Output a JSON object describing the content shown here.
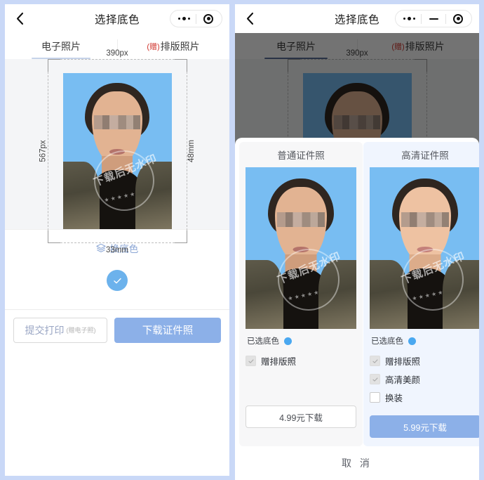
{
  "app": {
    "nav": {
      "title": "选择底色",
      "back_icon": "chevron-left-icon",
      "menu_icon": "more-dots-icon",
      "minimize_icon": "minimize-dash-icon",
      "target_icon": "target-circle-icon"
    },
    "tabs": [
      {
        "label": "电子照片",
        "gift": "",
        "active": true
      },
      {
        "label": "排版照片",
        "gift": "(赠)",
        "active": false
      }
    ]
  },
  "preview": {
    "width_px_label": "390px",
    "height_px_label": "567px",
    "width_mm_label": "33mm",
    "height_mm_label": "48mm",
    "watermark": "下载后无水印",
    "watermark_stars": "★ ★ ★ ★ ★",
    "background_color": "#78bdf2"
  },
  "change_color": {
    "label": "换底色",
    "icon": "layers-icon",
    "swatch_icon": "check-icon",
    "swatch_color": "#6cb2ec"
  },
  "actions": {
    "print_label": "提交打印",
    "print_sublabel": "(赠电子照)",
    "download_label": "下载证件照",
    "primary_color": "#8cb0e8"
  },
  "sheet": {
    "cards": [
      {
        "title": "普通证件照",
        "selected_label": "已选底色",
        "selected_color": "#4aa8f0",
        "options": [
          {
            "label": "赠排版照",
            "checked": true,
            "disabled": true
          }
        ],
        "button_label": "4.99元下载",
        "button_style": "ghost"
      },
      {
        "title": "高清证件照",
        "selected_label": "已选底色",
        "selected_color": "#4aa8f0",
        "options": [
          {
            "label": "赠排版照",
            "checked": true,
            "disabled": true
          },
          {
            "label": "高清美颜",
            "checked": true,
            "disabled": true
          },
          {
            "label": "换装",
            "checked": false,
            "disabled": false
          }
        ],
        "button_label": "5.99元下载",
        "button_style": "filled"
      }
    ],
    "cancel_label": "取 消"
  }
}
